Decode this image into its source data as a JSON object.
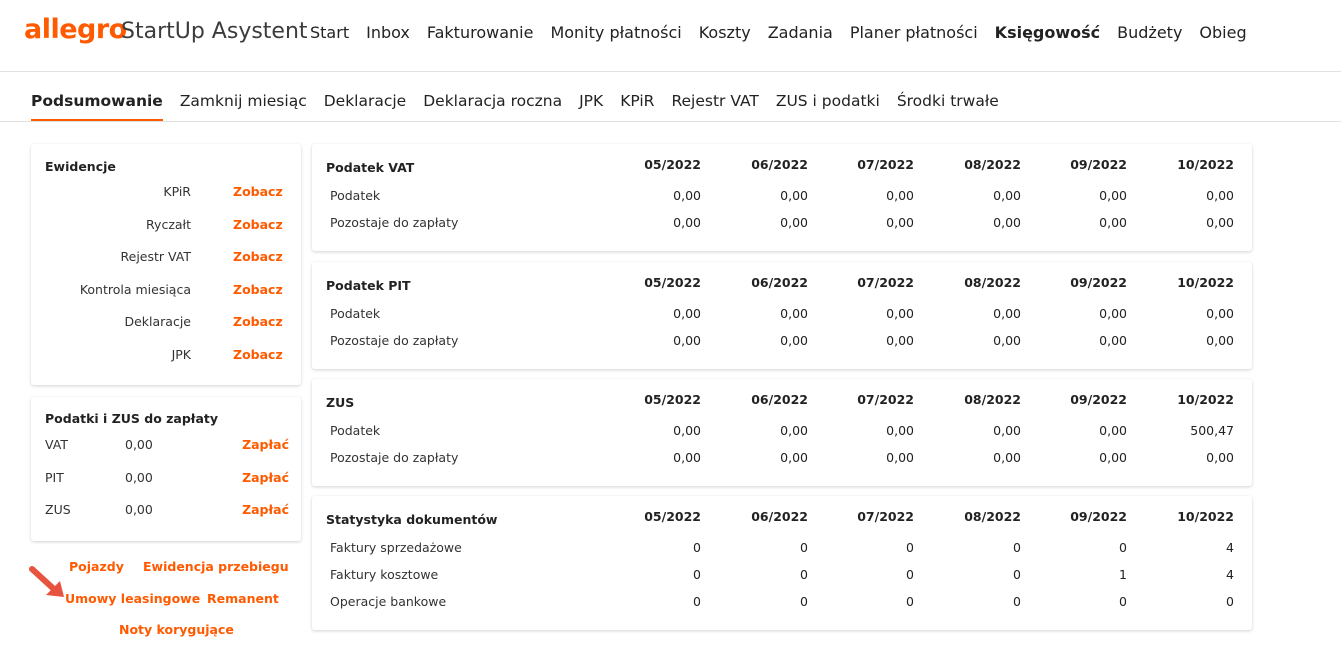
{
  "header": {
    "logo": "allegro",
    "product": "StartUp Asystent",
    "nav": [
      "Start",
      "Inbox",
      "Fakturowanie",
      "Monity płatności",
      "Koszty",
      "Zadania",
      "Planer płatności",
      "Księgowość",
      "Budżety",
      "Obieg"
    ],
    "active_nav": "Księgowość"
  },
  "subnav": {
    "items": [
      "Podsumowanie",
      "Zamknij miesiąc",
      "Deklaracje",
      "Deklaracja roczna",
      "JPK",
      "KPiR",
      "Rejestr VAT",
      "ZUS i podatki",
      "Środki trwałe"
    ],
    "active": "Podsumowanie"
  },
  "ewidencje": {
    "title": "Ewidencje",
    "link_label": "Zobacz",
    "items": [
      "KPiR",
      "Ryczałt",
      "Rejestr VAT",
      "Kontrola miesiąca",
      "Deklaracje",
      "JPK"
    ]
  },
  "podatki": {
    "title": "Podatki i ZUS do zapłaty",
    "link_label": "Zapłać",
    "rows": [
      {
        "name": "VAT",
        "value": "0,00"
      },
      {
        "name": "PIT",
        "value": "0,00"
      },
      {
        "name": "ZUS",
        "value": "0,00"
      }
    ]
  },
  "links": {
    "pojazdy": "Pojazdy",
    "ewidencja_przebiegu": "Ewidencja przebiegu",
    "umowy_leasingowe": "Umowy leasingowe",
    "remanent": "Remanent",
    "noty_korygujace": "Noty korygujące"
  },
  "months": [
    "05/2022",
    "06/2022",
    "07/2022",
    "08/2022",
    "09/2022",
    "10/2022"
  ],
  "tables": [
    {
      "title": "Podatek VAT",
      "rows": [
        {
          "label": "Podatek",
          "values": [
            "0,00",
            "0,00",
            "0,00",
            "0,00",
            "0,00",
            "0,00"
          ]
        },
        {
          "label": "Pozostaje do zapłaty",
          "values": [
            "0,00",
            "0,00",
            "0,00",
            "0,00",
            "0,00",
            "0,00"
          ]
        }
      ]
    },
    {
      "title": "Podatek PIT",
      "rows": [
        {
          "label": "Podatek",
          "values": [
            "0,00",
            "0,00",
            "0,00",
            "0,00",
            "0,00",
            "0,00"
          ]
        },
        {
          "label": "Pozostaje do zapłaty",
          "values": [
            "0,00",
            "0,00",
            "0,00",
            "0,00",
            "0,00",
            "0,00"
          ]
        }
      ]
    },
    {
      "title": "ZUS",
      "rows": [
        {
          "label": "Podatek",
          "values": [
            "0,00",
            "0,00",
            "0,00",
            "0,00",
            "0,00",
            "500,47"
          ]
        },
        {
          "label": "Pozostaje do zapłaty",
          "values": [
            "0,00",
            "0,00",
            "0,00",
            "0,00",
            "0,00",
            "0,00"
          ]
        }
      ]
    },
    {
      "title": "Statystyka dokumentów",
      "rows": [
        {
          "label": "Faktury sprzedażowe",
          "values": [
            "0",
            "0",
            "0",
            "0",
            "0",
            "4"
          ]
        },
        {
          "label": "Faktury kosztowe",
          "values": [
            "0",
            "0",
            "0",
            "0",
            "1",
            "4"
          ]
        },
        {
          "label": "Operacje bankowe",
          "values": [
            "0",
            "0",
            "0",
            "0",
            "0",
            "0"
          ]
        }
      ]
    }
  ],
  "colors": {
    "accent": "#ff5a00",
    "arrow": "#e8533f"
  }
}
